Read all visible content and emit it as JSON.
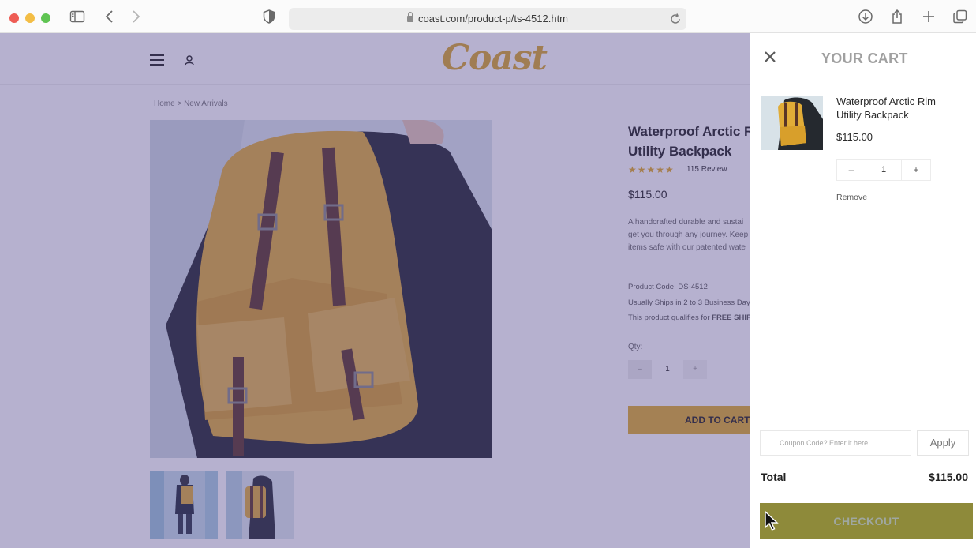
{
  "browser": {
    "url": "coast.com/product-p/ts-4512.htm",
    "icons": [
      "sidebar-icon",
      "back-icon",
      "forward-icon",
      "shield-icon",
      "reload-icon",
      "download-icon",
      "share-icon",
      "new-tab-icon",
      "tabs-icon"
    ]
  },
  "site": {
    "logo": "Coast",
    "breadcrumb": "Home > New Arrivals"
  },
  "product": {
    "title": "Waterproof Arctic Rim Utility Backpack",
    "title_visible": "Waterproof Arctic Ri­m\nBackpack",
    "rating": 5,
    "stars": "★★★★★",
    "reviews": "115 Review",
    "price": "$115.00",
    "description_lines": [
      "A handcrafted durable and sustai",
      "get you through any journey. Keep",
      "items safe with our patented wate"
    ],
    "product_code": "Product Code: DS-4512",
    "shipping": "Usually Ships in 2 to 3 Business Days",
    "free_shipping_prefix": "This product qualifies for ",
    "free_shipping_bold": "FREE SHIPPI",
    "qty_label": "Qty:",
    "qty_minus": "–",
    "qty_value": "1",
    "qty_plus": "+",
    "add_to_cart": "ADD TO CART"
  },
  "cart": {
    "title": "YOUR CART",
    "item": {
      "name": "Waterproof Arctic Rim Utility Backpack",
      "price": "$115.00",
      "qty_minus": "–",
      "qty": "1",
      "qty_plus": "+",
      "remove": "Remove"
    },
    "coupon_placeholder": "Coupon Code? Enter it here",
    "apply": "Apply",
    "total_label": "Total",
    "total_value": "$115.00",
    "checkout": "CHECKOUT"
  },
  "colors": {
    "accent": "#e0ad2b",
    "checkout_bg": "#8e8a3a",
    "overlay": "#50468c"
  }
}
